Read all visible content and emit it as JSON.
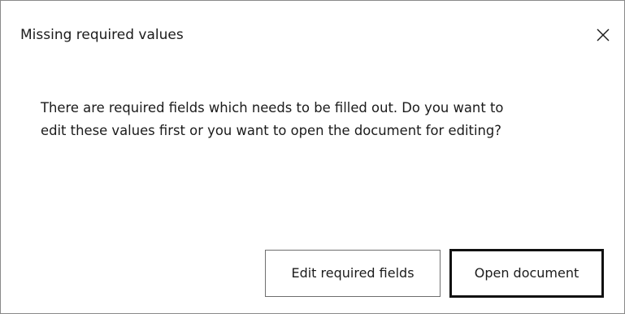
{
  "dialog": {
    "title": "Missing required values",
    "close_icon": "close-icon",
    "message_line1": "There are required fields which needs to be filled out. Do you want to",
    "message_line2": "edit these values first or you want to open the document for editing?",
    "buttons": {
      "edit_label": "Edit required fields",
      "open_label": "Open document"
    }
  },
  "colors": {
    "background": "#ffffff",
    "text": "#1b1b1b",
    "border": "#8a8a8a",
    "default_button_border": "#111111"
  }
}
